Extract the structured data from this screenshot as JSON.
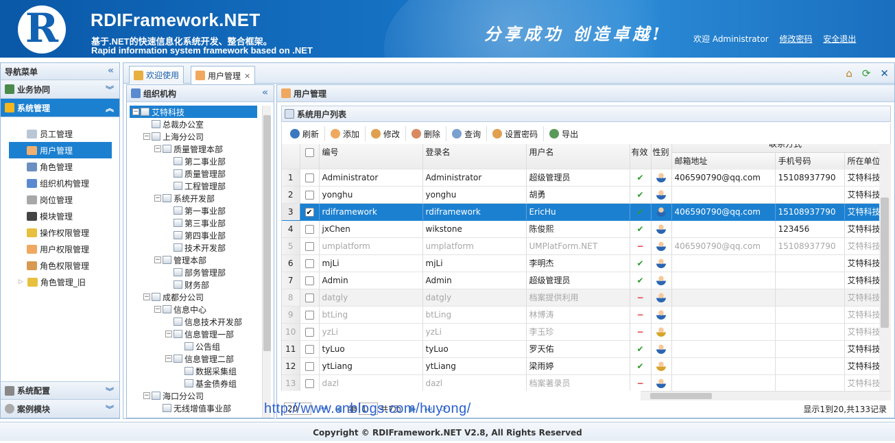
{
  "header": {
    "logo_letter": "R",
    "title": "RDIFramework.NET",
    "subtitle_cn": "基于.NET的快速信息化系统开发、整合框架。",
    "subtitle_en": "Rapid information system framework based on .NET",
    "slogan": "分享成功 创造卓越!",
    "welcome": "欢迎 Administrator",
    "change_password": "修改密码",
    "logout": "安全退出"
  },
  "nav": {
    "title": "导航菜单",
    "collapse": "«",
    "sections": [
      {
        "label": "业务协同"
      },
      {
        "label": "系统管理"
      }
    ],
    "items": [
      {
        "label": "员工管理"
      },
      {
        "label": "用户管理"
      },
      {
        "label": "角色管理"
      },
      {
        "label": "组织机构管理"
      },
      {
        "label": "岗位管理"
      },
      {
        "label": "模块管理"
      },
      {
        "label": "操作权限管理"
      },
      {
        "label": "用户权限管理"
      },
      {
        "label": "角色权限管理"
      },
      {
        "label": "角色管理_旧"
      }
    ],
    "bottom": [
      {
        "label": "系统配置"
      },
      {
        "label": "案例模块"
      }
    ]
  },
  "tabs": [
    {
      "label": "欢迎使用"
    },
    {
      "label": "用户管理",
      "close": "×"
    }
  ],
  "org": {
    "title": "组织机构",
    "collapse": "«",
    "nodes": [
      {
        "label": "艾特科技",
        "toggle": "−"
      },
      {
        "label": "总裁办公室"
      },
      {
        "label": "上海分公司",
        "toggle": "−"
      },
      {
        "label": "质量管理本部",
        "toggle": "−"
      },
      {
        "label": "第二事业部"
      },
      {
        "label": "质量管理部"
      },
      {
        "label": "工程管理部"
      },
      {
        "label": "系统开发部",
        "toggle": "−"
      },
      {
        "label": "第一事业部"
      },
      {
        "label": "第三事业部"
      },
      {
        "label": "第四事业部"
      },
      {
        "label": "技术开发部"
      },
      {
        "label": "管理本部",
        "toggle": "−"
      },
      {
        "label": "部务管理部"
      },
      {
        "label": "财务部"
      },
      {
        "label": "成都分公司",
        "toggle": "−"
      },
      {
        "label": "信息中心",
        "toggle": "−"
      },
      {
        "label": "信息技术开发部"
      },
      {
        "label": "信息管理一部",
        "toggle": "−"
      },
      {
        "label": "公告组"
      },
      {
        "label": "信息管理二部",
        "toggle": "−"
      },
      {
        "label": "数据采集组"
      },
      {
        "label": "基金债券组"
      },
      {
        "label": "海口分公司",
        "toggle": "−"
      },
      {
        "label": "无线增值事业部"
      }
    ]
  },
  "grid": {
    "panel_title": "用户管理",
    "list_title": "系统用户列表",
    "toolbar": [
      "刷新",
      "添加",
      "修改",
      "删除",
      "查询",
      "设置密码",
      "导出"
    ],
    "group_header": "联系方式",
    "columns": [
      "编号",
      "登录名",
      "用户名",
      "有效",
      "性别",
      "邮箱地址",
      "手机号码",
      "所在单位/公"
    ],
    "rows": [
      {
        "n": "1",
        "code": "Administrator",
        "login": "Administrator",
        "name": "超级管理员",
        "valid": "✔",
        "email": "406590790@qq.com",
        "phone": "15108937790",
        "unit": "艾特科技"
      },
      {
        "n": "2",
        "code": "yonghu",
        "login": "yonghu",
        "name": "胡勇",
        "valid": "✔",
        "email": "",
        "phone": "",
        "unit": "艾特科技"
      },
      {
        "n": "3",
        "code": "rdiframework",
        "login": "rdiframework",
        "name": "EricHu",
        "valid": "✔",
        "email": "406590790@qq.com",
        "phone": "15108937790",
        "unit": "艾特科技",
        "checked": "✔"
      },
      {
        "n": "4",
        "code": "jxChen",
        "login": "wikstone",
        "name": "陈俊熙",
        "valid": "✔",
        "email": "",
        "phone": "123456",
        "unit": "艾特科技"
      },
      {
        "n": "5",
        "code": "umplatform",
        "login": "umplatform",
        "name": "UMPlatForm.NET",
        "valid": "−",
        "email": "406590790@qq.com",
        "phone": "15108937790",
        "unit": "艾特科技"
      },
      {
        "n": "6",
        "code": "mjLi",
        "login": "mjLi",
        "name": "李明杰",
        "valid": "✔",
        "email": "",
        "phone": "",
        "unit": "艾特科技"
      },
      {
        "n": "7",
        "code": "Admin",
        "login": "Admin",
        "name": "超级管理员",
        "valid": "✔",
        "email": "",
        "phone": "",
        "unit": "艾特科技"
      },
      {
        "n": "8",
        "code": "datgly",
        "login": "datgly",
        "name": "档案提供利用",
        "valid": "−",
        "email": "",
        "phone": "",
        "unit": "艾特科技"
      },
      {
        "n": "9",
        "code": "btLing",
        "login": "btLing",
        "name": "林博涛",
        "valid": "−",
        "email": "",
        "phone": "",
        "unit": "艾特科技"
      },
      {
        "n": "10",
        "code": "yzLi",
        "login": "yzLi",
        "name": "李玉珍",
        "valid": "−",
        "email": "",
        "phone": "",
        "unit": "艾特科技"
      },
      {
        "n": "11",
        "code": "tyLuo",
        "login": "tyLuo",
        "name": "罗天佑",
        "valid": "✔",
        "email": "",
        "phone": "",
        "unit": "艾特科技"
      },
      {
        "n": "12",
        "code": "ytLiang",
        "login": "ytLiang",
        "name": "梁雨婷",
        "valid": "✔",
        "email": "",
        "phone": "",
        "unit": "艾特科技"
      },
      {
        "n": "13",
        "code": "dazl",
        "login": "dazl",
        "name": "档案著录员",
        "valid": "−",
        "email": "",
        "phone": "",
        "unit": "艾特科技"
      }
    ]
  },
  "pager": {
    "page_size": "20",
    "page_prefix": "第",
    "page": "1",
    "page_suffix": "共7页",
    "info": "显示1到20,共133记录"
  },
  "watermark": "http://www.cnblogs.com/huyong/",
  "footer": "Copyright © RDIFramework.NET V2.8, All Rights Reserved",
  "colors": {
    "header": "#1672c4",
    "selected": "#1c80d0",
    "ok": "#2d9b2d",
    "no": "#e33333"
  }
}
